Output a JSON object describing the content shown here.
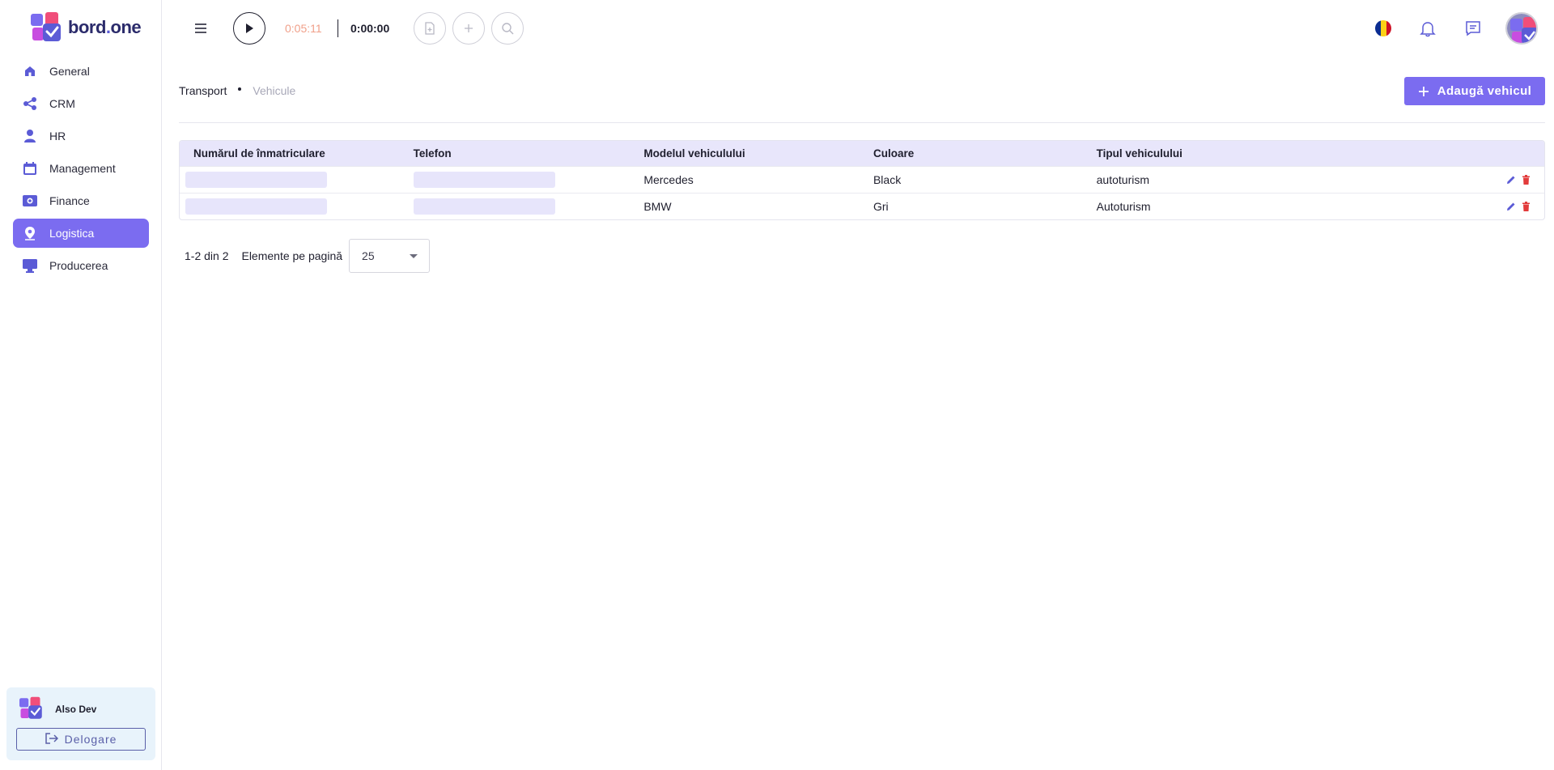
{
  "app": {
    "logo_text_main": "bord",
    "logo_text_dot": ".",
    "logo_text_end": "one"
  },
  "sidebar": {
    "items": [
      {
        "label": "General",
        "icon": "home-icon",
        "active": false
      },
      {
        "label": "CRM",
        "icon": "share-icon",
        "active": false
      },
      {
        "label": "HR",
        "icon": "person-icon",
        "active": false
      },
      {
        "label": "Management",
        "icon": "calendar-icon",
        "active": false
      },
      {
        "label": "Finance",
        "icon": "money-icon",
        "active": false
      },
      {
        "label": "Logistica",
        "icon": "location-icon",
        "active": true
      },
      {
        "label": "Producerea",
        "icon": "monitor-icon",
        "active": false
      }
    ],
    "user_name": "Also Dev",
    "logout_label": "Delogare"
  },
  "topbar": {
    "timer_session": "0:05:11",
    "timer_task": "0:00:00",
    "flag": "romania-flag",
    "colors": {
      "accent": "#7b6cf0",
      "timer_session": "#f0a08a"
    }
  },
  "breadcrumb": {
    "parent": "Transport",
    "current": "Vehicule"
  },
  "actions": {
    "add_vehicle_label": "Adaugă vehicul"
  },
  "table": {
    "columns": [
      "Numărul de înmatriculare",
      "Telefon",
      "Modelul vehiculului",
      "Culoare",
      "Tipul vehiculului"
    ],
    "rows": [
      {
        "model": "Mercedes",
        "color": "Black",
        "type": "autoturism"
      },
      {
        "model": "BMW",
        "color": "Gri",
        "type": "Autoturism"
      }
    ]
  },
  "pagination": {
    "range": "1-2 din 2",
    "per_page_label": "Elemente pe pagină",
    "per_page_value": "25"
  }
}
